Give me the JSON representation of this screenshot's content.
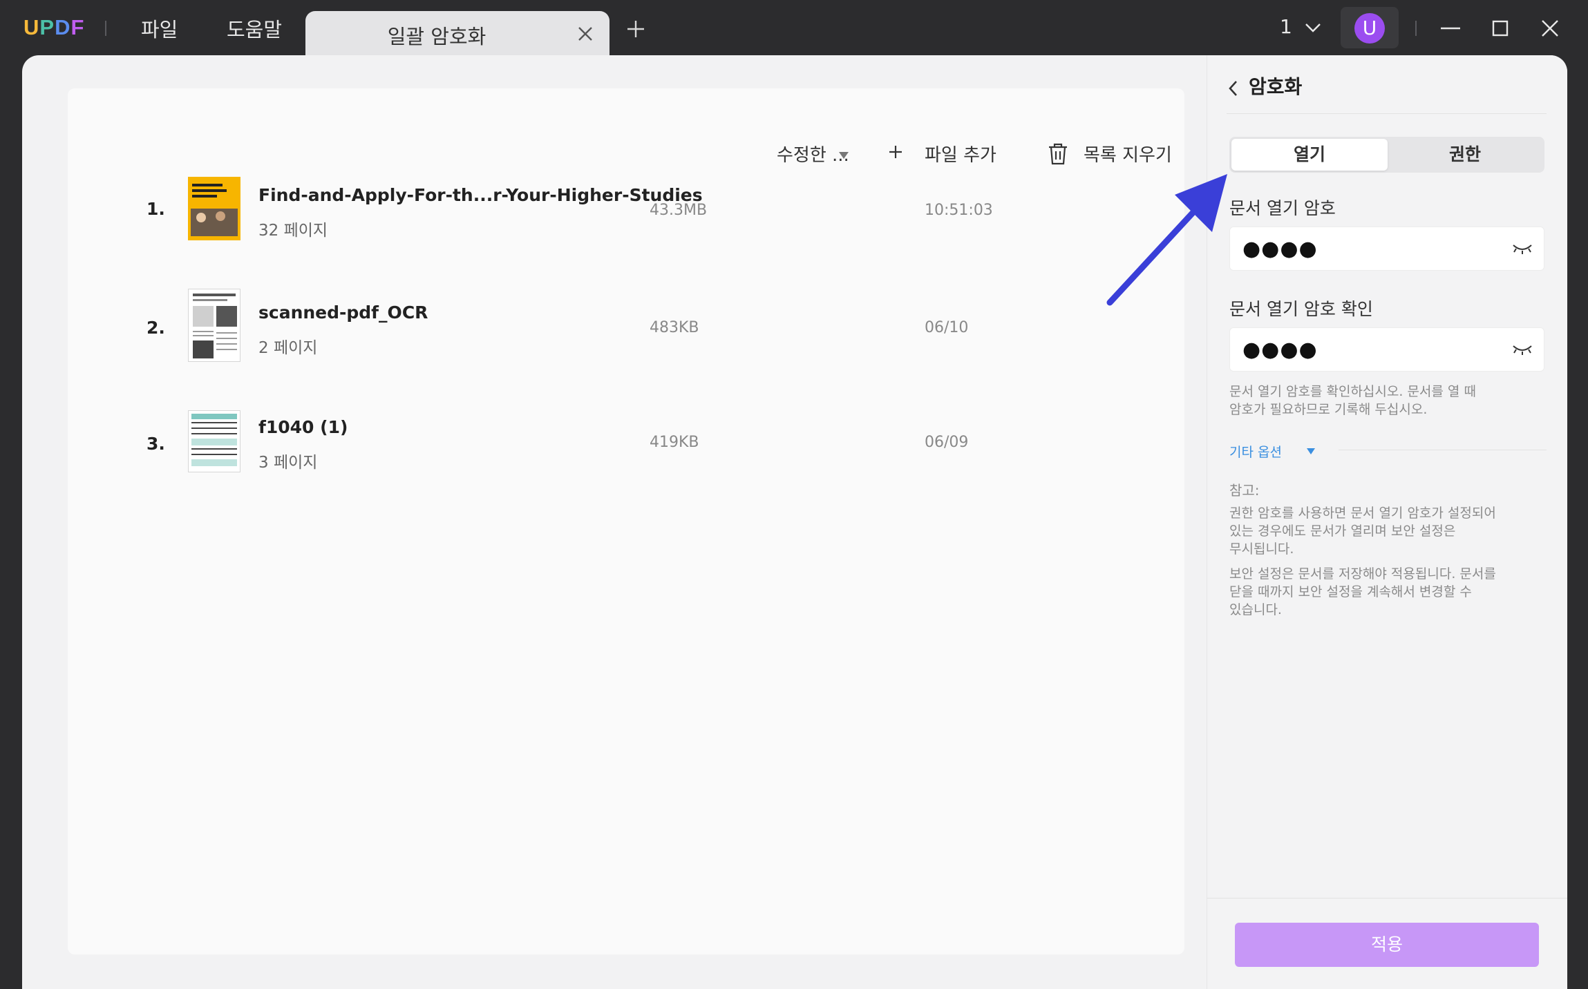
{
  "app": {
    "logo": [
      "U",
      "P",
      "D",
      "F"
    ],
    "menu": {
      "file": "파일",
      "help": "도움말"
    },
    "active_tab": "일괄 암호화",
    "zoom": "1",
    "avatar_letter": "U"
  },
  "toolbar": {
    "sort_label": "수정한 ...",
    "add_file_label": "파일 추가",
    "clear_list_label": "목록 지우기"
  },
  "files": [
    {
      "index": "1.",
      "name": "Find-and-Apply-For-th...r-Your-Higher-Studies",
      "pages": "32 페이지",
      "size": "43.3MB",
      "date": "10:51:03"
    },
    {
      "index": "2.",
      "name": "scanned-pdf_OCR",
      "pages": "2 페이지",
      "size": "483KB",
      "date": "06/10"
    },
    {
      "index": "3.",
      "name": "f1040 (1)",
      "pages": "3 페이지",
      "size": "419KB",
      "date": "06/09"
    }
  ],
  "panel": {
    "title": "암호화",
    "tabs": {
      "open": "열기",
      "permission": "권한"
    },
    "open_password_label": "문서 열기 암호",
    "open_password_value": "●●●●",
    "confirm_password_label": "문서 열기 암호 확인",
    "confirm_password_value": "●●●●",
    "hint_1": "문서 열기 암호를 확인하십시오. 문서를 열 때",
    "hint_2": "암호가 필요하므로 기록해 두십시오.",
    "more_options": "기타 옵션",
    "note_title": "참고:",
    "note_1a": "권한 암호를 사용하면 문서 열기 암호가 설정되어",
    "note_1b": "있는 경우에도 문서가 열리며 보안 설정은",
    "note_1c": "무시됩니다.",
    "note_2a": "보안 설정은 문서를 저장해야 적용됩니다. 문서를",
    "note_2b": "닫을 때까지 보안 설정을 계속해서 변경할 수",
    "note_2c": "있습니다.",
    "apply_label": "적용"
  },
  "colors": {
    "accent": "#c797f7",
    "link": "#3a8fe0",
    "avatar": "#9b4df0",
    "annotation_arrow": "#3a3fd8"
  }
}
